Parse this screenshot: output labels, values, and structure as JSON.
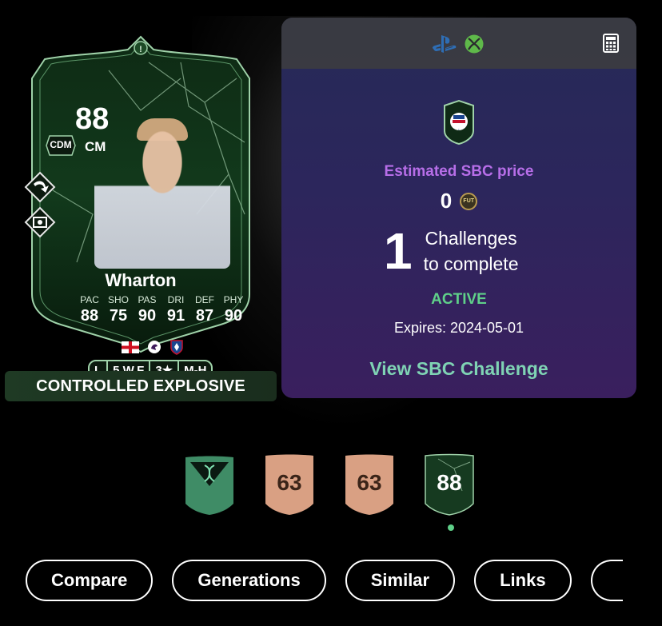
{
  "card": {
    "rating": "88",
    "position": "CM",
    "alt_position": "CDM",
    "name": "Wharton",
    "stats": [
      {
        "label": "PAC",
        "value": "88"
      },
      {
        "label": "SHO",
        "value": "75"
      },
      {
        "label": "PAS",
        "value": "90"
      },
      {
        "label": "DRI",
        "value": "91"
      },
      {
        "label": "DEF",
        "value": "87"
      },
      {
        "label": "PHY",
        "value": "90"
      }
    ],
    "chips": [
      "L",
      "5 W.F",
      "3★",
      "M-H"
    ],
    "accent_color": "#9fd2a9"
  },
  "playstyle": "CONTROLLED EXPLOSIVE",
  "sbc": {
    "estimated_label": "Estimated SBC price",
    "price": "0",
    "coin_label": "FUT",
    "challenges_count": "1",
    "challenges_line1": "Challenges",
    "challenges_line2": "to complete",
    "status": "ACTIVE",
    "expires": "Expires: 2024-05-01",
    "view_button": "View SBC Challenge",
    "platform_icons": [
      "playstation-icon",
      "xbox-icon"
    ],
    "status_color": "#5fd089",
    "price_label_color": "#b76ee8"
  },
  "versions": [
    {
      "type": "evolution",
      "label": ""
    },
    {
      "type": "bronze",
      "label": "63"
    },
    {
      "type": "bronze",
      "label": "63"
    },
    {
      "type": "special",
      "label": "88",
      "selected": true
    }
  ],
  "tabs": [
    "Compare",
    "Generations",
    "Similar",
    "Links"
  ]
}
